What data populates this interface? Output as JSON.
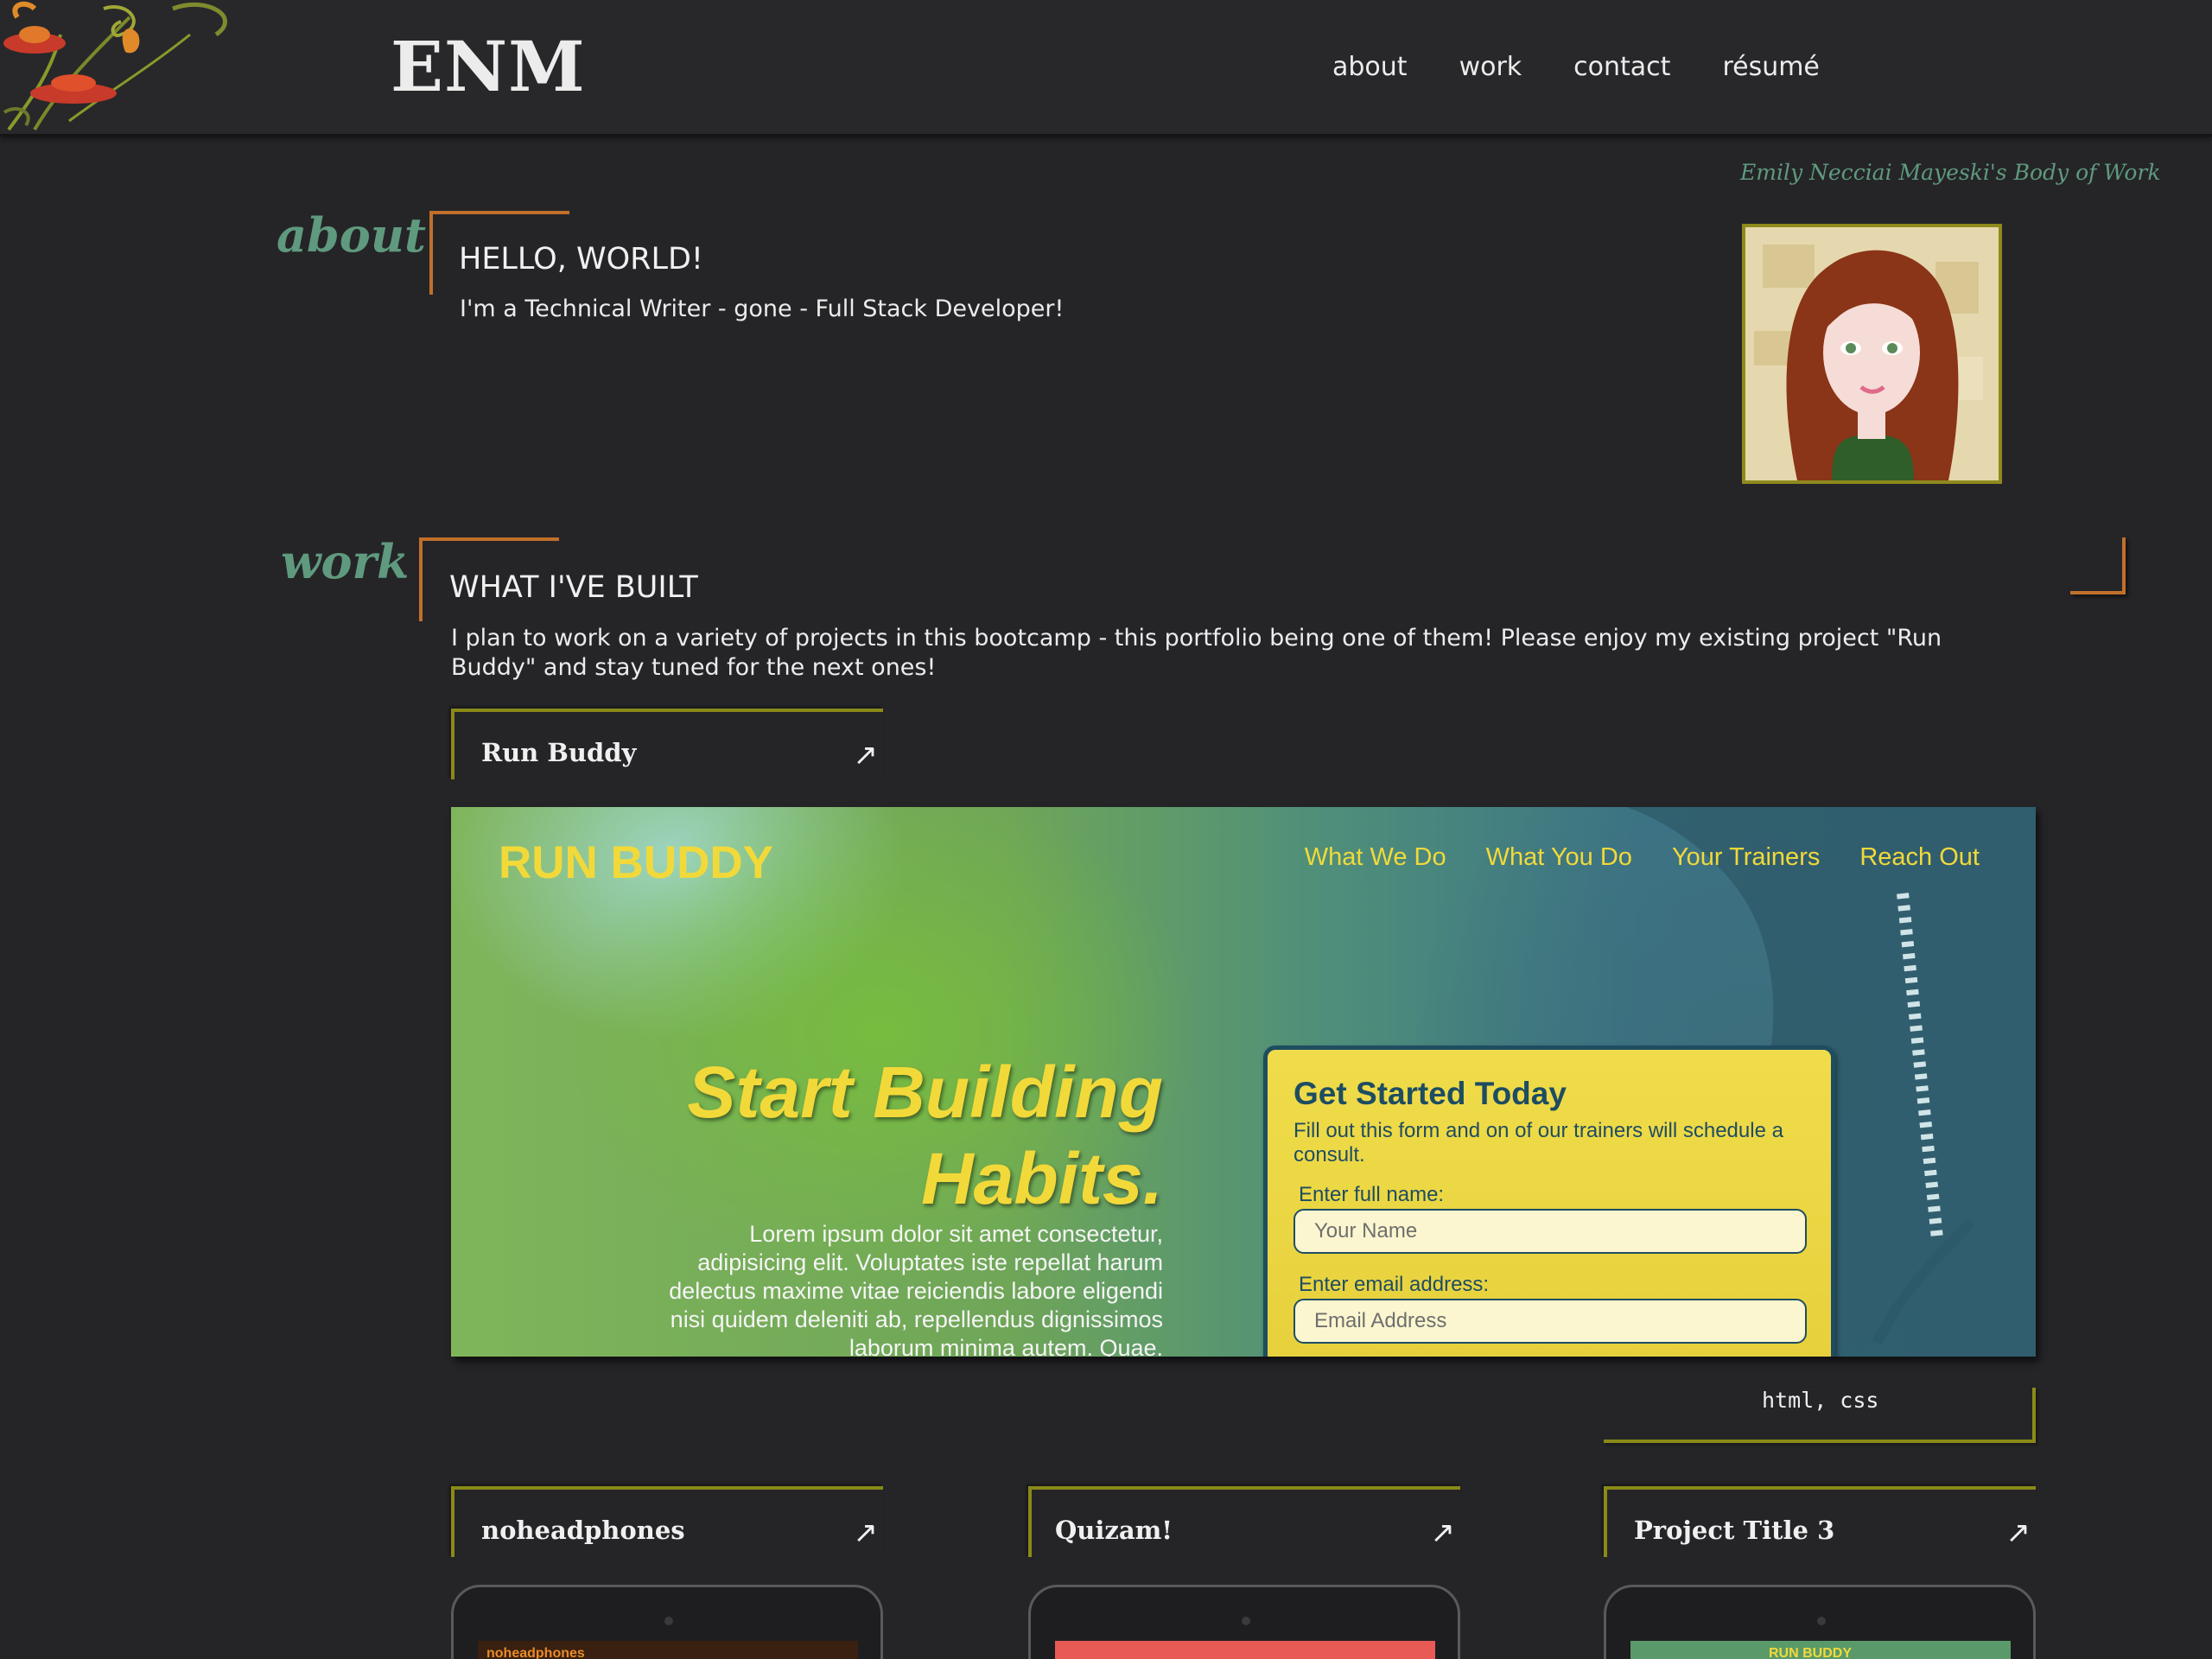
{
  "header": {
    "logo": "ENM",
    "nav": [
      "about",
      "work",
      "contact",
      "résumé"
    ]
  },
  "tagline": "Emily Necciai Mayeski's Body of Work",
  "about": {
    "label": "about",
    "heading": "HELLO, WORLD!",
    "text": "I'm a Technical Writer - gone - Full Stack Developer!"
  },
  "work": {
    "label": "work",
    "heading": "WHAT I'VE BUILT",
    "text": "I plan to work on a variety of projects in this bootcamp - this portfolio being one of them! Please enjoy my existing project \"Run Buddy\" and stay tuned for the next ones!"
  },
  "featured": {
    "title": "Run Buddy",
    "arrow": "↗",
    "tags": "html, css",
    "preview": {
      "logo": "RUN BUDDY",
      "nav": [
        "What We Do",
        "What You Do",
        "Your Trainers",
        "Reach Out"
      ],
      "hero_line1": "Start Building",
      "hero_line2": "Habits.",
      "lorem": "Lorem ipsum dolor sit amet consectetur, adipisicing elit. Voluptates iste repellat harum delectus maxime vitae reiciendis labore eligendi nisi quidem deleniti ab, repellendus dignissimos laborum minima autem. Quae.",
      "form_title": "Get Started Today",
      "form_desc": "Fill out this form and on of our trainers will schedule a consult.",
      "name_label": "Enter full name:",
      "name_placeholder": "Your Name",
      "email_label": "Enter email address:",
      "email_placeholder": "Email Address"
    }
  },
  "projects": [
    {
      "title": "noheadphones",
      "arrow": "↗",
      "screen_text": "noheadphones",
      "screen_color": "#3a2010",
      "text_color": "#e88a2a"
    },
    {
      "title": "Quizam!",
      "arrow": "↗",
      "screen_text": "",
      "screen_color": "#e85a55",
      "text_color": "#ffffff"
    },
    {
      "title": "Project Title 3",
      "arrow": "↗",
      "screen_text": "RUN BUDDY",
      "screen_color": "#5a9a6a",
      "text_color": "#f2d93a"
    }
  ],
  "colors": {
    "background": "#252528",
    "accent_green": "#5f9a7e",
    "accent_orange": "#c0702a",
    "accent_olive": "#8a8a18",
    "runbuddy_yellow": "#f2d93a"
  }
}
